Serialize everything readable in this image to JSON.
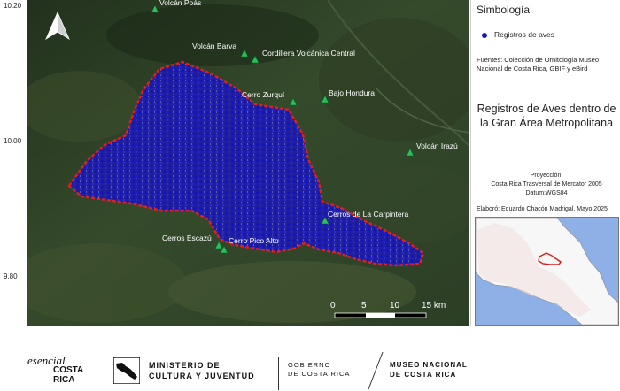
{
  "map": {
    "lat_labels": [
      "10.20",
      "10.00",
      "9.80"
    ],
    "places": [
      {
        "name": "Volcán Poás"
      },
      {
        "name": "Volcán Barva"
      },
      {
        "name": "Cordillera Volcánica Central"
      },
      {
        "name": "Cerro Zurquí"
      },
      {
        "name": "Bajo Hondura"
      },
      {
        "name": "Volcán Irazú"
      },
      {
        "name": "Cerros de La Carpintera"
      },
      {
        "name": "Cerros Escazú"
      },
      {
        "name": "Cerro Pico Alto"
      }
    ],
    "scale": {
      "ticks": [
        "0",
        "5",
        "10",
        "15 km"
      ]
    },
    "colors": {
      "area_outline": "#e0201c",
      "records": "#1414c8",
      "peak_marker": "#2bbf5a"
    }
  },
  "panel": {
    "legend_title": "Simbología",
    "legend_item": "Registros de aves",
    "sources": "Fuentes: Colección de Ornitología Museo Nacional de Costa Rica, GBIF y eBird",
    "title": "Registros de Aves dentro de la Gran Área Metropolitana",
    "projection_label": "Proyección:",
    "projection_value": "Costa Rica Trasversal de Mercator 2005",
    "datum": "Datum:WGS84",
    "credit": "Elaboró: Eduardo Chacón Madrigal, Mayo 2025"
  },
  "footer": {
    "logo_cr_script": "esencial",
    "logo_cr_text": "COSTA RICA",
    "ministerio": "MINISTERIO DE",
    "cultura": "CULTURA Y JUVENTUD",
    "gobierno": "GOBIERNO",
    "gob_de_cr": "DE COSTA RICA",
    "museo": "MUSEO NACIONAL",
    "museo_de_cr": "DE COSTA RICA"
  }
}
